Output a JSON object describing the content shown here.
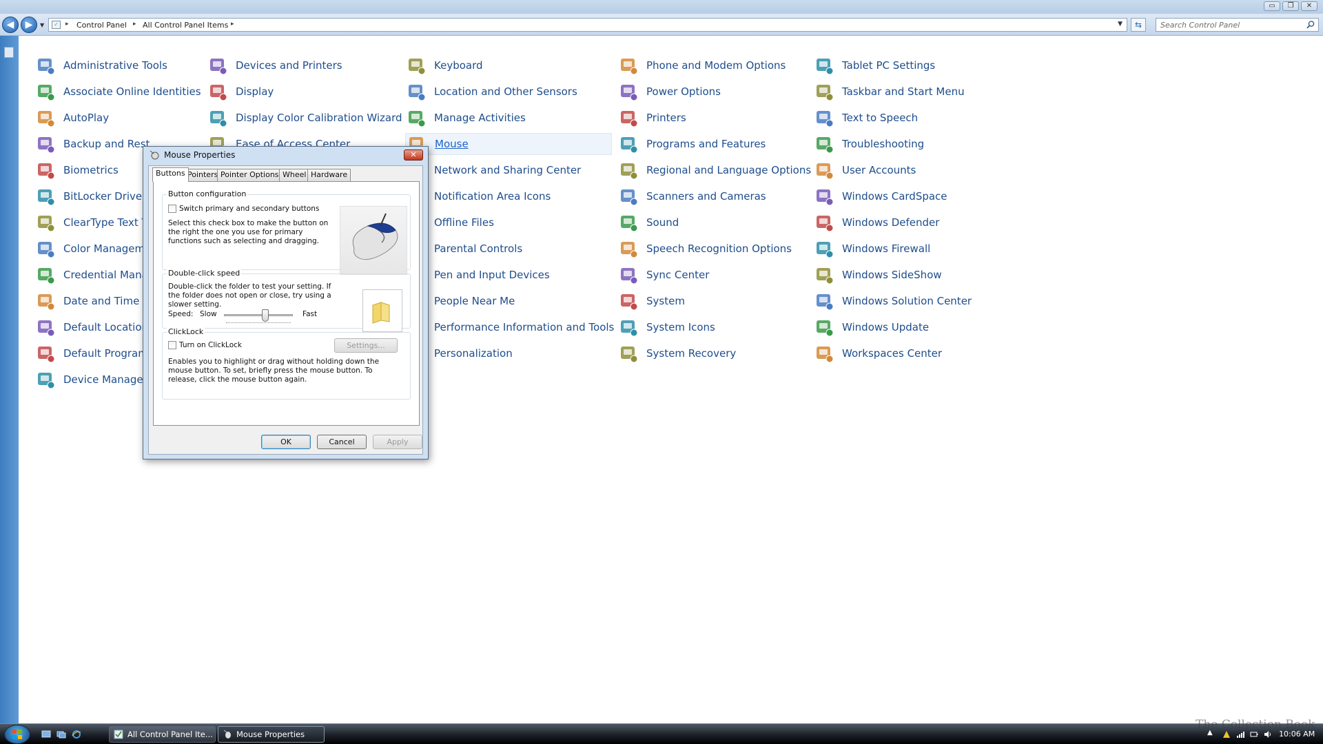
{
  "window": {
    "minimize": "▭",
    "restore": "❐",
    "close": "✕"
  },
  "nav": {
    "breadcrumbs": [
      "Control Panel",
      "All Control Panel Items"
    ],
    "search_placeholder": "Search Control Panel"
  },
  "columns": [
    [
      "Administrative Tools",
      "Associate Online Identities",
      "AutoPlay",
      "Backup and Restore Center",
      "Biometrics",
      "BitLocker Drive Encryption",
      "ClearType Text Tuner",
      "Color Management",
      "Credential Manager",
      "Date and Time",
      "Default Locations",
      "Default Programs",
      "Device Manager"
    ],
    [
      "Devices and Printers",
      "Display",
      "Display Color Calibration Wizard",
      "Ease of Access Center"
    ],
    [
      "Keyboard",
      "Location and Other Sensors",
      "Manage Activities",
      "Mouse",
      "Network and Sharing Center",
      "Notification Area Icons",
      "Offline Files",
      "Parental Controls",
      "Pen and Input Devices",
      "People Near Me",
      "Performance Information and Tools",
      "Personalization"
    ],
    [
      "Phone and Modem Options",
      "Power Options",
      "Printers",
      "Programs and Features",
      "Regional and Language Options",
      "Scanners and Cameras",
      "Sound",
      "Speech Recognition Options",
      "Sync Center",
      "System",
      "System Icons",
      "System Recovery"
    ],
    [
      "Tablet PC Settings",
      "Taskbar and Start Menu",
      "Text to Speech",
      "Troubleshooting",
      "User Accounts",
      "Windows CardSpace",
      "Windows Defender",
      "Windows Firewall",
      "Windows SideShow",
      "Windows Solution Center",
      "Windows Update",
      "Workspaces Center"
    ]
  ],
  "col0_visible": [
    "Administrative Tools",
    "Associate Online Identities",
    "AutoPlay",
    "Backup and Rest",
    "Biometrics",
    "BitLocker Drive E",
    "ClearType Text T",
    "Color Managem",
    "Credential Mana",
    "Date and Time",
    "Default Location",
    "Default Program",
    "Device Manager"
  ],
  "col1_visible": [
    "Devices and Printers",
    "Display",
    "Display Color Calibration Wizard",
    "Ease of Access Center"
  ],
  "dialog": {
    "title": "Mouse Properties",
    "tabs": [
      "Buttons",
      "Pointers",
      "Pointer Options",
      "Wheel",
      "Hardware"
    ],
    "active_tab": "Buttons",
    "button_config": {
      "title": "Button configuration",
      "checkbox": "Switch primary and secondary buttons",
      "desc": "Select this check box to make the button on the right the one you use for primary functions such as selecting and dragging."
    },
    "double_click": {
      "title": "Double-click speed",
      "desc": "Double-click the folder to test your setting. If the folder does not open or close, try using a slower setting.",
      "speed": "Speed:",
      "slow": "Slow",
      "fast": "Fast",
      "level": 0.6
    },
    "clicklock": {
      "title": "ClickLock",
      "checkbox": "Turn on ClickLock",
      "settings": "Settings...",
      "desc": "Enables you to highlight or drag without holding down the mouse button. To set, briefly press the mouse button. To release, click the mouse button again."
    },
    "ok": "OK",
    "cancel": "Cancel",
    "apply": "Apply"
  },
  "taskbar": {
    "buttons": [
      "All Control Panel Ite...",
      "Mouse Properties"
    ],
    "clock": "10:06 AM",
    "watermark": "The Collection Book"
  },
  "colors": {
    "link": "#1e4d8c",
    "accent": "#1f5fae"
  }
}
